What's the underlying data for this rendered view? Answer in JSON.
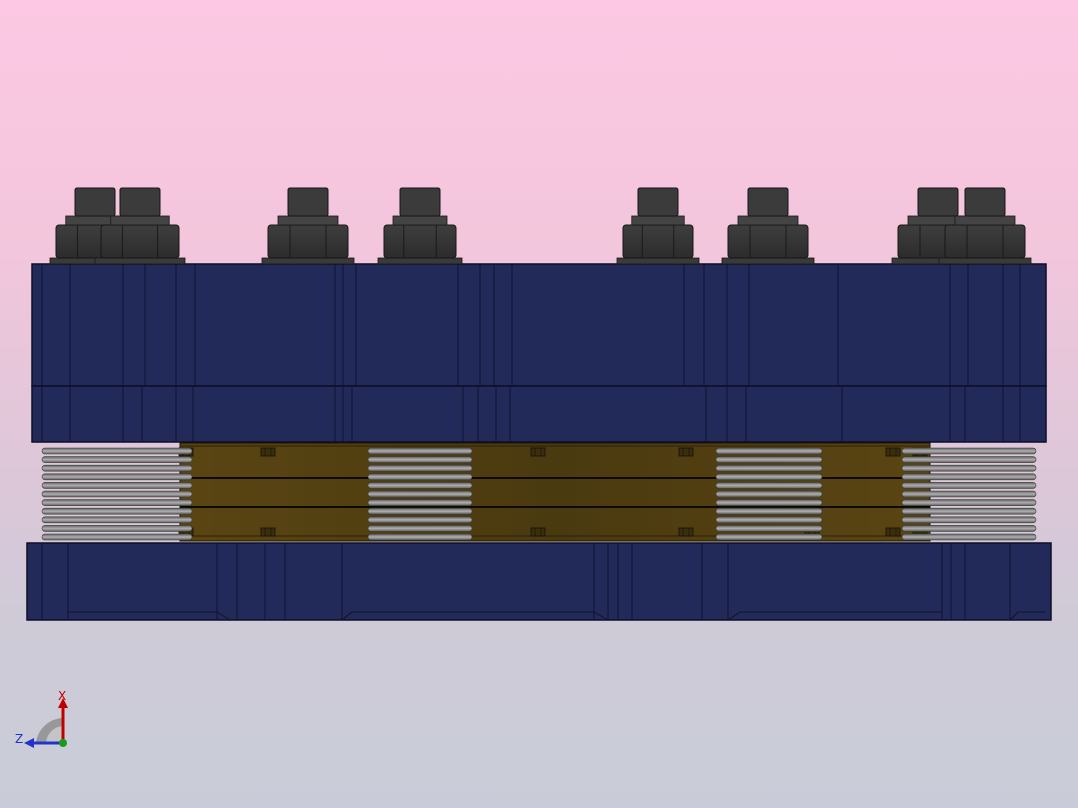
{
  "viewport": {
    "background_top": "#fcc8e3",
    "background_bottom": "#c9ccd8"
  },
  "model": {
    "colors": {
      "plate": "#222a5a",
      "plate_edge": "#0c0f26",
      "spring": "#8a8a8a",
      "guide": "#4d3c14",
      "nut": "#4a4a4a"
    }
  },
  "triad": {
    "x_label": "X",
    "z_label": "Z",
    "x_color": "#c00000",
    "z_color": "#2233cc",
    "y_color": "#1a9a1a"
  }
}
